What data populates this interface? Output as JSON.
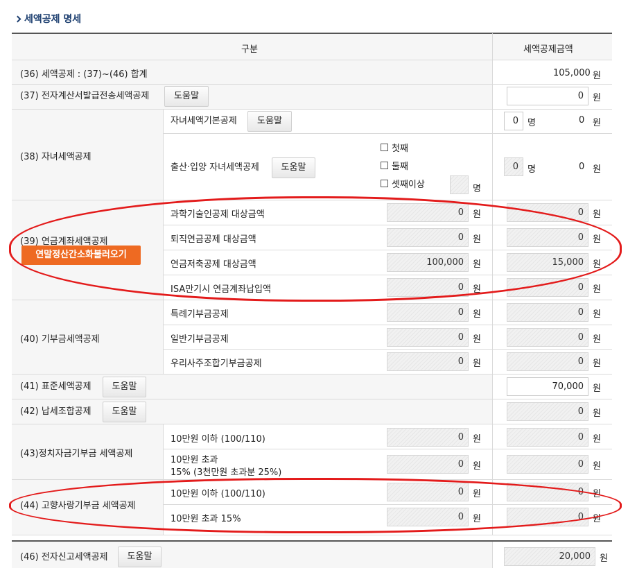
{
  "section_title": "세액공제 명세",
  "header": {
    "col1": "구분",
    "col2": "세액공제금액"
  },
  "unit_won": "원",
  "unit_person": "명",
  "help_label": "도움말",
  "rows": {
    "r36": {
      "label": "(36) 세액공제 : (37)~(46) 합계",
      "amount": "105,000"
    },
    "r37": {
      "label": "(37) 전자계산서발급전송세액공제",
      "amount": "0"
    },
    "r38": {
      "label": "(38) 자녀세액공제",
      "basic": {
        "label": "자녀세액기본공제",
        "count": "0",
        "amount": "0"
      },
      "birth": {
        "label": "출산·입양 자녀세액공제",
        "options": [
          "첫째",
          "둘째",
          "셋째이상"
        ],
        "count": "0",
        "amount": "0"
      }
    },
    "r39": {
      "label": "(39) 연금계좌세액공제",
      "load_button": "연말정산간소화불러오기",
      "items": [
        {
          "label": "과학기술인공제 대상금액",
          "base": "0",
          "amount": "0"
        },
        {
          "label": "퇴직연금공제 대상금액",
          "base": "0",
          "amount": "0"
        },
        {
          "label": "연금저축공제 대상금액",
          "base": "100,000",
          "amount": "15,000"
        },
        {
          "label": "ISA만기시 연금계좌납입액",
          "base": "0",
          "amount": "0"
        }
      ]
    },
    "r40": {
      "label": "(40) 기부금세액공제",
      "items": [
        {
          "label": "특례기부금공제",
          "base": "0",
          "amount": "0"
        },
        {
          "label": "일반기부금공제",
          "base": "0",
          "amount": "0"
        },
        {
          "label": "우리사주조합기부금공제",
          "base": "0",
          "amount": "0"
        }
      ]
    },
    "r41": {
      "label": "(41) 표준세액공제",
      "amount": "70,000"
    },
    "r42": {
      "label": "(42) 납세조합공제",
      "amount": "0"
    },
    "r43": {
      "label": "(43)정치자금기부금 세액공제",
      "items": [
        {
          "label": "10만원 이하 (100/110)",
          "base": "0",
          "amount": "0"
        },
        {
          "label1": "10만원 초과",
          "label2": "15% (3천만원 초과분 25%)",
          "base": "0",
          "amount": "0"
        }
      ]
    },
    "r44": {
      "label": "(44) 고향사랑기부금 세액공제",
      "items": [
        {
          "label": "10만원 이하 (100/110)",
          "base": "0",
          "amount": "0"
        },
        {
          "label": "10만원 초과 15%",
          "base": "0",
          "amount": "0"
        }
      ]
    },
    "r46": {
      "label": "(46) 전자신고세액공제",
      "amount": "20,000"
    }
  },
  "colors": {
    "highlight": "#e31b1b",
    "orange_button": "#ee6a22",
    "title": "#1d3f70"
  }
}
